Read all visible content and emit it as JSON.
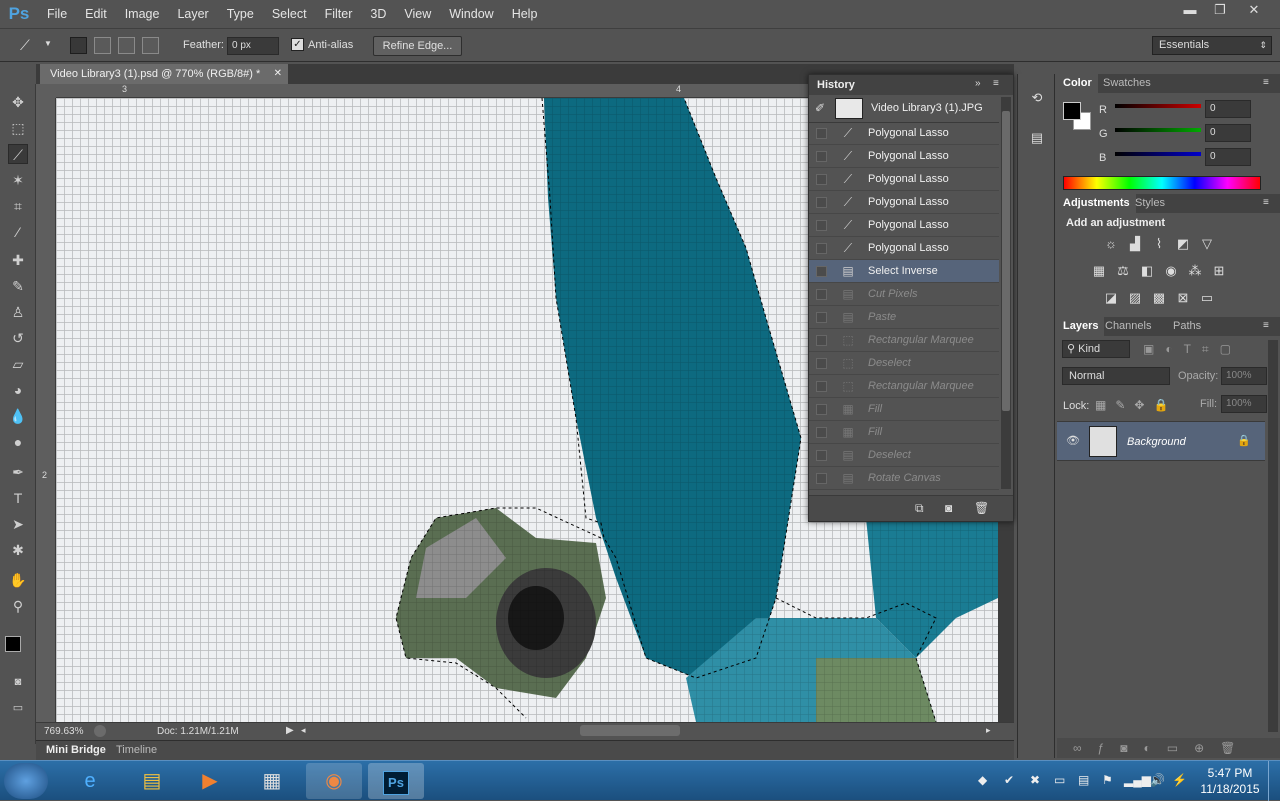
{
  "app": {
    "logo": "Ps"
  },
  "menu": [
    "File",
    "Edit",
    "Image",
    "Layer",
    "Type",
    "Select",
    "Filter",
    "3D",
    "View",
    "Window",
    "Help"
  ],
  "window_controls": {
    "minimize": "▬",
    "restore": "❐",
    "close": "✕"
  },
  "options": {
    "feather_label": "Feather:",
    "feather_value": "0 px",
    "antialias_label": "Anti-alias",
    "antialias_checked": true,
    "refine_edge_label": "Refine Edge...",
    "workspace": "Essentials"
  },
  "document": {
    "tab_title": "Video Library3 (1).psd @ 770% (RGB/8#) *",
    "ruler_top_labels": [
      "3",
      "4"
    ],
    "ruler_left_labels": [
      "2"
    ],
    "zoom": "769.63%",
    "doc_info": "Doc: 1.21M/1.21M"
  },
  "bottom_tabs": [
    "Mini Bridge",
    "Timeline"
  ],
  "history": {
    "title": "History",
    "snapshot_name": "Video Library3 (1).JPG",
    "items": [
      {
        "label": "Polygonal Lasso",
        "icon": "lasso-icon",
        "state": "normal"
      },
      {
        "label": "Polygonal Lasso",
        "icon": "lasso-icon",
        "state": "normal"
      },
      {
        "label": "Polygonal Lasso",
        "icon": "lasso-icon",
        "state": "normal"
      },
      {
        "label": "Polygonal Lasso",
        "icon": "lasso-icon",
        "state": "normal"
      },
      {
        "label": "Polygonal Lasso",
        "icon": "lasso-icon",
        "state": "normal"
      },
      {
        "label": "Polygonal Lasso",
        "icon": "lasso-icon",
        "state": "normal"
      },
      {
        "label": "Select Inverse",
        "icon": "document-icon",
        "state": "selected"
      },
      {
        "label": "Cut Pixels",
        "icon": "document-icon",
        "state": "dimmed"
      },
      {
        "label": "Paste",
        "icon": "document-icon",
        "state": "dimmed"
      },
      {
        "label": "Rectangular Marquee",
        "icon": "marquee-icon",
        "state": "dimmed"
      },
      {
        "label": "Deselect",
        "icon": "marquee-icon",
        "state": "dimmed"
      },
      {
        "label": "Rectangular Marquee",
        "icon": "marquee-icon",
        "state": "dimmed"
      },
      {
        "label": "Fill",
        "icon": "fill-icon",
        "state": "dimmed"
      },
      {
        "label": "Fill",
        "icon": "fill-icon",
        "state": "dimmed"
      },
      {
        "label": "Deselect",
        "icon": "document-icon",
        "state": "dimmed"
      },
      {
        "label": "Rotate Canvas",
        "icon": "document-icon",
        "state": "dimmed"
      }
    ]
  },
  "color_panel": {
    "tabs": [
      "Color",
      "Swatches"
    ],
    "channels": [
      {
        "label": "R",
        "value": "0",
        "color": "#cc0000"
      },
      {
        "label": "G",
        "value": "0",
        "color": "#00aa00"
      },
      {
        "label": "B",
        "value": "0",
        "color": "#0000cc"
      }
    ]
  },
  "adjustments_panel": {
    "tabs": [
      "Adjustments",
      "Styles"
    ],
    "heading": "Add an adjustment"
  },
  "layers_panel": {
    "tabs": [
      "Layers",
      "Channels",
      "Paths"
    ],
    "filter_kind": "Kind",
    "blend_mode": "Normal",
    "opacity_label": "Opacity:",
    "opacity_value": "100%",
    "lock_label": "Lock:",
    "fill_label": "Fill:",
    "fill_value": "100%",
    "layers": [
      {
        "name": "Background",
        "locked": true,
        "visible": true
      }
    ]
  },
  "taskbar": {
    "apps": [
      "start-orb",
      "internet-explorer-icon",
      "file-explorer-icon",
      "media-player-icon",
      "calculator-icon",
      "chrome-icon",
      "photoshop-taskbar-icon"
    ],
    "photoshop_label": "Ps",
    "time": "5:47 PM",
    "date": "11/18/2015"
  }
}
